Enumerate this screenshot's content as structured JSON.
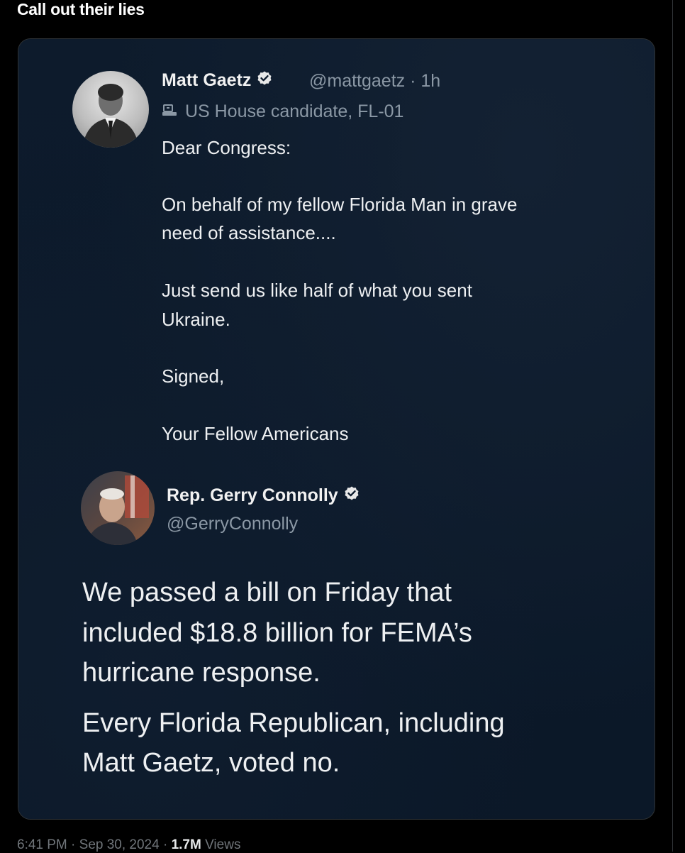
{
  "post": {
    "text": "Call out their lies"
  },
  "quoted_tweet": {
    "author_name": "Matt Gaetz",
    "handle_time": "@mattgaetz · 1h",
    "label": "US House candidate, FL-01",
    "lines": [
      "Dear Congress:",
      "On behalf of my fellow Florida Man in grave",
      "need of assistance....",
      "Just send us like half of what you sent",
      "Ukraine.",
      "Signed,",
      "Your Fellow Americans"
    ]
  },
  "reply_tweet": {
    "author_name": "Rep. Gerry Connolly",
    "handle": "@GerryConnolly",
    "lines": [
      "We passed a bill on Friday that",
      "included $18.8 billion for FEMA’s",
      "hurricane response.",
      "Every Florida Republican, including",
      "Matt Gaetz, voted no."
    ]
  },
  "footer": {
    "time": "6:41 PM · Sep 30, 2024 · ",
    "views_count": "1.7M",
    "views_label": " Views"
  },
  "colors": {
    "background": "#000000",
    "card_background": "#0c1a2b",
    "handle_gray": "#8b98a5",
    "border": "#2f3336"
  }
}
